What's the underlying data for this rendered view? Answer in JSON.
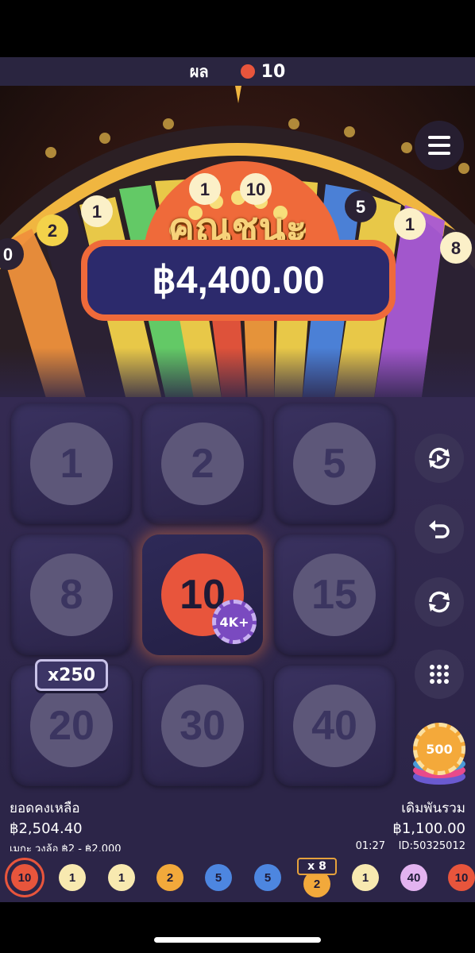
{
  "result_bar": {
    "label": "ผล",
    "result_value": "10",
    "result_color": "#e8553c"
  },
  "win": {
    "title": "คุณชนะ",
    "amount": "฿4,400.00"
  },
  "wheel": {
    "visible_segments": [
      "0",
      "2",
      "1",
      "1",
      "10",
      "1",
      "5",
      "1",
      "8"
    ]
  },
  "board": {
    "tiles": [
      {
        "label": "1"
      },
      {
        "label": "2"
      },
      {
        "label": "5"
      },
      {
        "label": "8"
      },
      {
        "label": "10"
      },
      {
        "label": "15"
      },
      {
        "label": "20"
      },
      {
        "label": "30"
      },
      {
        "label": "40"
      }
    ],
    "active_tile": "10",
    "bet_chip_label": "4K+",
    "multiplier_tag": "x250"
  },
  "controls": {
    "icons": [
      "menu-icon",
      "auto-spin-icon",
      "undo-icon",
      "repeat-icon",
      "keypad-icon"
    ],
    "chip_value": "500"
  },
  "info": {
    "balance_label": "ยอดคงเหลือ",
    "balance_value": "฿2,504.40",
    "limits_text": "เมกะ วงล้อ   ฿2 - ฿2,000",
    "total_bet_label": "เดิมพันรวม",
    "total_bet_value": "฿1,100.00",
    "time": "01:27",
    "round_id": "ID:50325012"
  },
  "history": {
    "items": [
      {
        "value": "10",
        "color": "#e8553c"
      },
      {
        "value": "1",
        "color": "#f8e9b0"
      },
      {
        "value": "1",
        "color": "#f8e9b0"
      },
      {
        "value": "2",
        "color": "#f2a93b"
      },
      {
        "value": "5",
        "color": "#4d86e0"
      },
      {
        "value": "5",
        "color": "#4d86e0"
      },
      {
        "value": "2",
        "color": "#f2a93b"
      },
      {
        "value": "1",
        "color": "#f8e9b0"
      },
      {
        "value": "40",
        "color": "#e3b3f0"
      },
      {
        "value": "10",
        "color": "#e8553c"
      }
    ],
    "multiplier_badge": "x 8"
  }
}
